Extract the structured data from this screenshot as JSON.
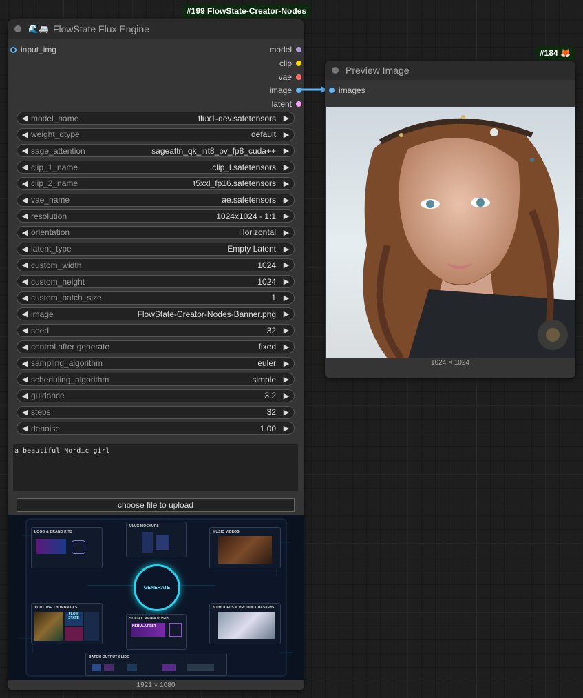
{
  "main_node": {
    "badge": "#199 FlowState-Creator-Nodes",
    "title_icons": "🌊🚐",
    "title": "FlowState Flux Engine",
    "input_label": "input_img",
    "outputs": [
      {
        "label": "model",
        "color": "#b39ddb"
      },
      {
        "label": "clip",
        "color": "#ffd500"
      },
      {
        "label": "vae",
        "color": "#ff6e6e"
      },
      {
        "label": "image",
        "color": "#64b5f6"
      },
      {
        "label": "latent",
        "color": "#ff9cf9"
      }
    ],
    "widgets": [
      {
        "name": "model_name",
        "value": "flux1-dev.safetensors"
      },
      {
        "name": "weight_dtype",
        "value": "default"
      },
      {
        "name": "sage_attention",
        "value": "sageattn_qk_int8_pv_fp8_cuda++"
      },
      {
        "name": "clip_1_name",
        "value": "clip_l.safetensors"
      },
      {
        "name": "clip_2_name",
        "value": "t5xxl_fp16.safetensors"
      },
      {
        "name": "vae_name",
        "value": "ae.safetensors"
      },
      {
        "name": "resolution",
        "value": "1024x1024 - 1:1"
      },
      {
        "name": "orientation",
        "value": "Horizontal"
      },
      {
        "name": "latent_type",
        "value": "Empty Latent"
      },
      {
        "name": "custom_width",
        "value": "1024"
      },
      {
        "name": "custom_height",
        "value": "1024"
      },
      {
        "name": "custom_batch_size",
        "value": "1"
      },
      {
        "name": "image",
        "value": "FlowState-Creator-Nodes-Banner.png"
      },
      {
        "name": "seed",
        "value": "32"
      },
      {
        "name": "control after generate",
        "value": "fixed"
      },
      {
        "name": "sampling_algorithm",
        "value": "euler"
      },
      {
        "name": "scheduling_algorithm",
        "value": "simple"
      },
      {
        "name": "guidance",
        "value": "3.2"
      },
      {
        "name": "steps",
        "value": "32"
      },
      {
        "name": "denoise",
        "value": "1.00"
      }
    ],
    "prompt_text": "a beautiful Nordic girl",
    "upload_label": "choose file to upload",
    "image_caption": "1921 × 1080",
    "banner": {
      "panels": [
        "LOGO & BRAND KITS",
        "UI/UX MOCKUPS",
        "MUSIC VIDEOS",
        "YOUTUBE THUMBNAILS",
        "SOCIAL MEDIA POSTS",
        "3D MODELS & PRODUCT DESIGNS",
        "BATCH OUTPUT SLIDE"
      ],
      "generate_label": "GENERATE",
      "thumb_text_1": "FLOW STATE",
      "thumb_text_2": "NEBULA FEST"
    }
  },
  "preview_node": {
    "badge": "#184 🦊",
    "title": "Preview Image",
    "input_label": "images",
    "caption": "1024 × 1024"
  },
  "colors": {
    "image_link": "#64b5f6",
    "badge_bg": "#0d2a10"
  }
}
